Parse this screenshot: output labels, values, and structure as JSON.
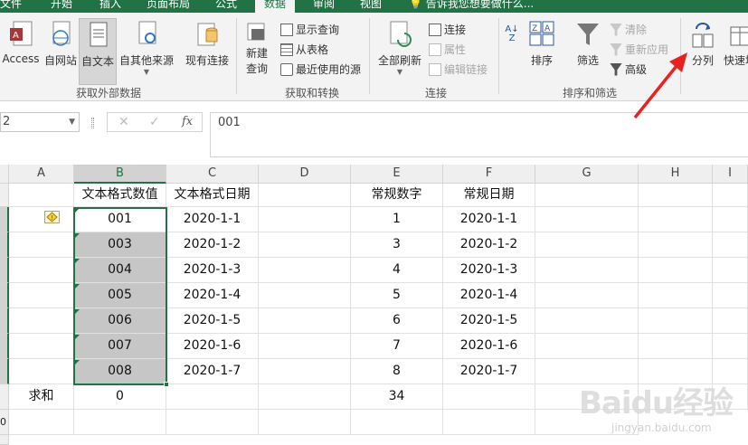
{
  "tabs": [
    {
      "label": "文件",
      "active": false
    },
    {
      "label": "开始",
      "active": false
    },
    {
      "label": "插入",
      "active": false
    },
    {
      "label": "页面布局",
      "active": false
    },
    {
      "label": "公式",
      "active": false
    },
    {
      "label": "数据",
      "active": true
    },
    {
      "label": "审阅",
      "active": false
    },
    {
      "label": "视图",
      "active": false
    }
  ],
  "tell_me": "告诉我您想要做什么...",
  "ribbon": {
    "get_external": {
      "label": "获取外部数据",
      "buttons": [
        "Access",
        "自网站",
        "自文本",
        "自其他来源",
        "现有连接"
      ]
    },
    "get_transform": {
      "label": "获取和转换",
      "new_query": "新建\n查询",
      "new_query_l1": "新建",
      "new_query_l2": "查询",
      "items": [
        "显示查询",
        "从表格",
        "最近使用的源"
      ]
    },
    "connections": {
      "label": "连接",
      "refresh_all": "全部刷新",
      "items": [
        "连接",
        "属性",
        "编辑链接"
      ]
    },
    "sort_filter": {
      "label": "排序和筛选",
      "sort": "排序",
      "filter": "筛选",
      "items": [
        "清除",
        "重新应用",
        "高级"
      ]
    },
    "data_tools": {
      "text_to_columns": "分列",
      "flash_fill": "快速填"
    }
  },
  "formula": {
    "name_box": "2",
    "cancel": "✕",
    "enter": "✓",
    "fx": "fx",
    "content": "001"
  },
  "columns": [
    "A",
    "B",
    "C",
    "D",
    "E",
    "F",
    "G",
    "H",
    "I"
  ],
  "headers": {
    "B": "文本格式数值",
    "C": "文本格式日期",
    "E": "常规数字",
    "F": "常规日期"
  },
  "rows": [
    {
      "b": "001",
      "c": "2020-1-1",
      "e": "1",
      "f": "2020-1-1"
    },
    {
      "b": "003",
      "c": "2020-1-2",
      "e": "3",
      "f": "2020-1-2"
    },
    {
      "b": "004",
      "c": "2020-1-3",
      "e": "4",
      "f": "2020-1-3"
    },
    {
      "b": "005",
      "c": "2020-1-4",
      "e": "5",
      "f": "2020-1-4"
    },
    {
      "b": "006",
      "c": "2020-1-5",
      "e": "6",
      "f": "2020-1-5"
    },
    {
      "b": "007",
      "c": "2020-1-6",
      "e": "7",
      "f": "2020-1-6"
    },
    {
      "b": "008",
      "c": "2020-1-7",
      "e": "8",
      "f": "2020-1-7"
    }
  ],
  "sum_row": {
    "a": "求和",
    "b": "0",
    "e": "34"
  },
  "row_number_bottom": "0",
  "watermark": {
    "main": "Baidu经验",
    "sub": "jingyan.baidu.com"
  },
  "colors": {
    "excel_green": "#217346",
    "arrow_red": "#e8231f",
    "selection_fill": "#c6c6c6"
  }
}
